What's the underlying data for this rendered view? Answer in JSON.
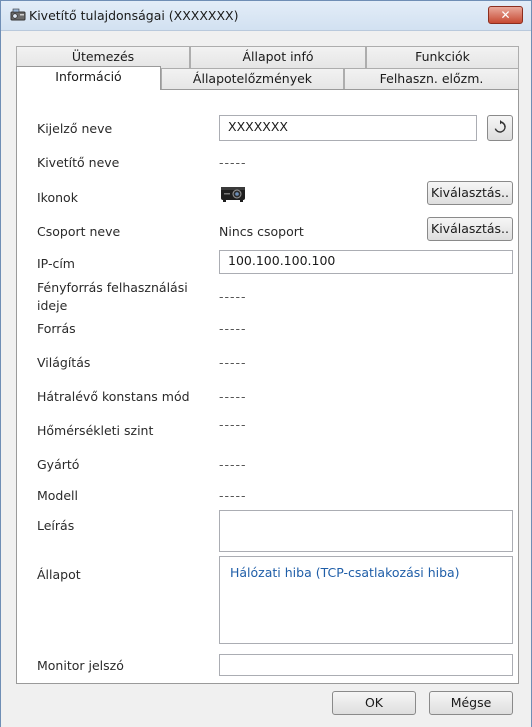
{
  "window": {
    "title": "Kivetítő tulajdonságai (XXXXXXX)",
    "close_label": "✕"
  },
  "tabs": {
    "row1": [
      "Ütemezés",
      "Állapot infó",
      "Funkciók"
    ],
    "row2": [
      "Információ",
      "Állapotelőzmények",
      "Felhaszn. előzm."
    ]
  },
  "fields": {
    "display_name": {
      "label": "Kijelző neve",
      "value": "XXXXXXX"
    },
    "projector_name": {
      "label": "Kivetítő neve",
      "value": "-----"
    },
    "icons": {
      "label": "Ikonok",
      "button": "Kiválasztás.."
    },
    "group_name": {
      "label": "Csoport neve",
      "value": "Nincs csoport",
      "button": "Kiválasztás.."
    },
    "ip": {
      "label": "IP-cím",
      "value": "100.100.100.100"
    },
    "light_hours": {
      "label_line1": "Fényforrás felhasználási",
      "label_line2": "ideje",
      "value": "-----"
    },
    "source": {
      "label": "Forrás",
      "value": "-----"
    },
    "brightness": {
      "label": "Világítás",
      "value": "-----"
    },
    "constant_mode": {
      "label": "Hátralévő konstans mód",
      "value": "-----"
    },
    "temperature": {
      "label": "Hőmérsékleti szint",
      "value": "-----"
    },
    "manufacturer": {
      "label": "Gyártó",
      "value": "-----"
    },
    "model": {
      "label": "Modell",
      "value": "-----"
    },
    "description": {
      "label": "Leírás",
      "value": ""
    },
    "status": {
      "label": "Állapot",
      "value": "Hálózati hiba (TCP-csatlakozási hiba)"
    },
    "monitor_password": {
      "label": "Monitor jelszó",
      "value": ""
    }
  },
  "footer": {
    "ok": "OK",
    "cancel": "Mégse"
  }
}
